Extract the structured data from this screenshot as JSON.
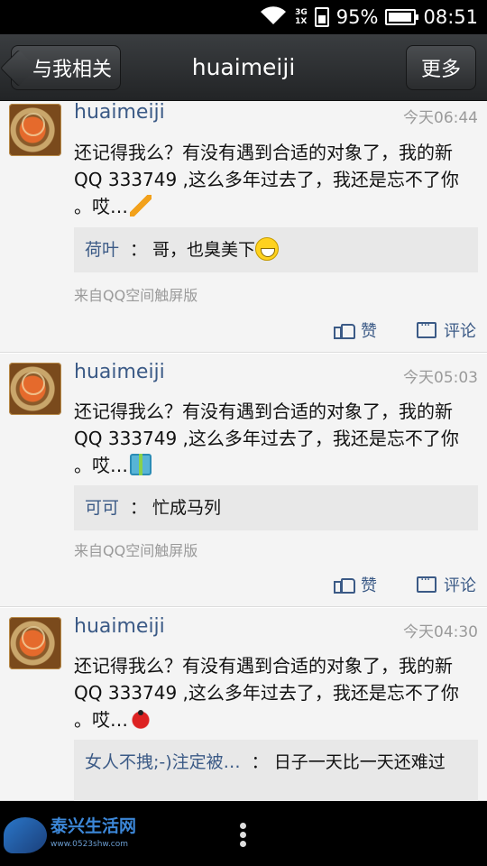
{
  "status_bar": {
    "network_top": "3G",
    "network_bottom": "1X",
    "battery": "95%",
    "time": "08:51"
  },
  "header": {
    "back_label": "与我相关",
    "title": "huaimeiji",
    "more_label": "更多"
  },
  "posts": [
    {
      "username": "huaimeiji",
      "time": "今天06:44",
      "text": "还记得我么？有没有遇到合适的对象了，我的新QQ 333749 ,这么多年过去了，我还是忘不了你 。哎…",
      "emoji": "lightning-icon",
      "reply_name": "荷叶",
      "reply_sep": "：",
      "reply_text": "哥，也臭美下",
      "reply_emoji": "grin-icon",
      "source": "来自QQ空间触屏版",
      "like_label": "赞",
      "comment_label": "评论"
    },
    {
      "username": "huaimeiji",
      "time": "今天05:03",
      "text": "还记得我么？有没有遇到合适的对象了，我的新QQ 333749 ,这么多年过去了，我还是忘不了你 。哎…",
      "emoji": "gift-icon",
      "reply_name": "可可",
      "reply_sep": "：",
      "reply_text": "忙成马列",
      "source": "来自QQ空间触屏版",
      "like_label": "赞",
      "comment_label": "评论"
    },
    {
      "username": "huaimeiji",
      "time": "今天04:30",
      "text": "还记得我么？有没有遇到合适的对象了，我的新QQ 333749 ,这么多年过去了，我还是忘不了你 。哎…",
      "emoji": "ladybug-icon",
      "reply_name": "女人不拽;-)注定被…",
      "reply_sep": "：",
      "reply_text": "日子一天比一天还难过"
    }
  ],
  "watermark": {
    "title": "泰兴生活网",
    "url": "www.0523shw.com"
  }
}
